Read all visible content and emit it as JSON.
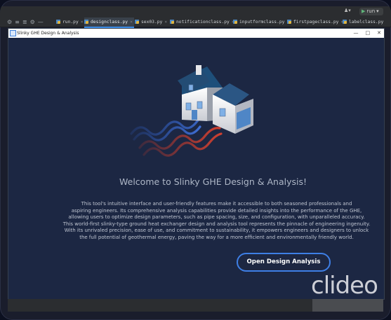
{
  "ide": {
    "run_config_label": "run",
    "tabs": [
      {
        "label": "run.py",
        "active": false
      },
      {
        "label": "designclass.py",
        "active": true
      },
      {
        "label": "sex03.py",
        "active": false
      },
      {
        "label": "notificationclass.py",
        "active": false
      },
      {
        "label": "inputformclass.py",
        "active": false
      },
      {
        "label": "firstpageclass.py",
        "active": false
      },
      {
        "label": "labelclass.py",
        "active": false
      }
    ]
  },
  "app": {
    "window_title": "Slinky GHE Design & Analysis",
    "welcome_heading": "Welcome to Slinky GHE Design & Analysis!",
    "description_lines": [
      "This tool's intuitive interface and user-friendly features make it accessible to both seasoned professionals and",
      "aspiring engineers. Its comprehensive analysis capabilities provide detailed insights into the performance of the GHE,",
      "allowing users to optimize design parameters, such as pipe spacing, size, and configuration, with unparalleled accuracy.",
      "This world-first slinky-type ground heat exchanger design and analysis tool represents the pinnacle of engineering ingenuity.",
      "With its unrivaled precision, ease of use, and commitment to sustainability, it empowers engineers and designers to unlock",
      "the full potential of geothermal energy, paving the way for a more efficient and environmentally friendly world."
    ],
    "open_button_label": "Open Design  Analysis"
  },
  "watermark": "clideo",
  "colors": {
    "app_bg": "#1c2743",
    "button_border": "#3e7fe6",
    "pipe_hot": "#c0392b",
    "pipe_cold": "#2e5bbf"
  }
}
